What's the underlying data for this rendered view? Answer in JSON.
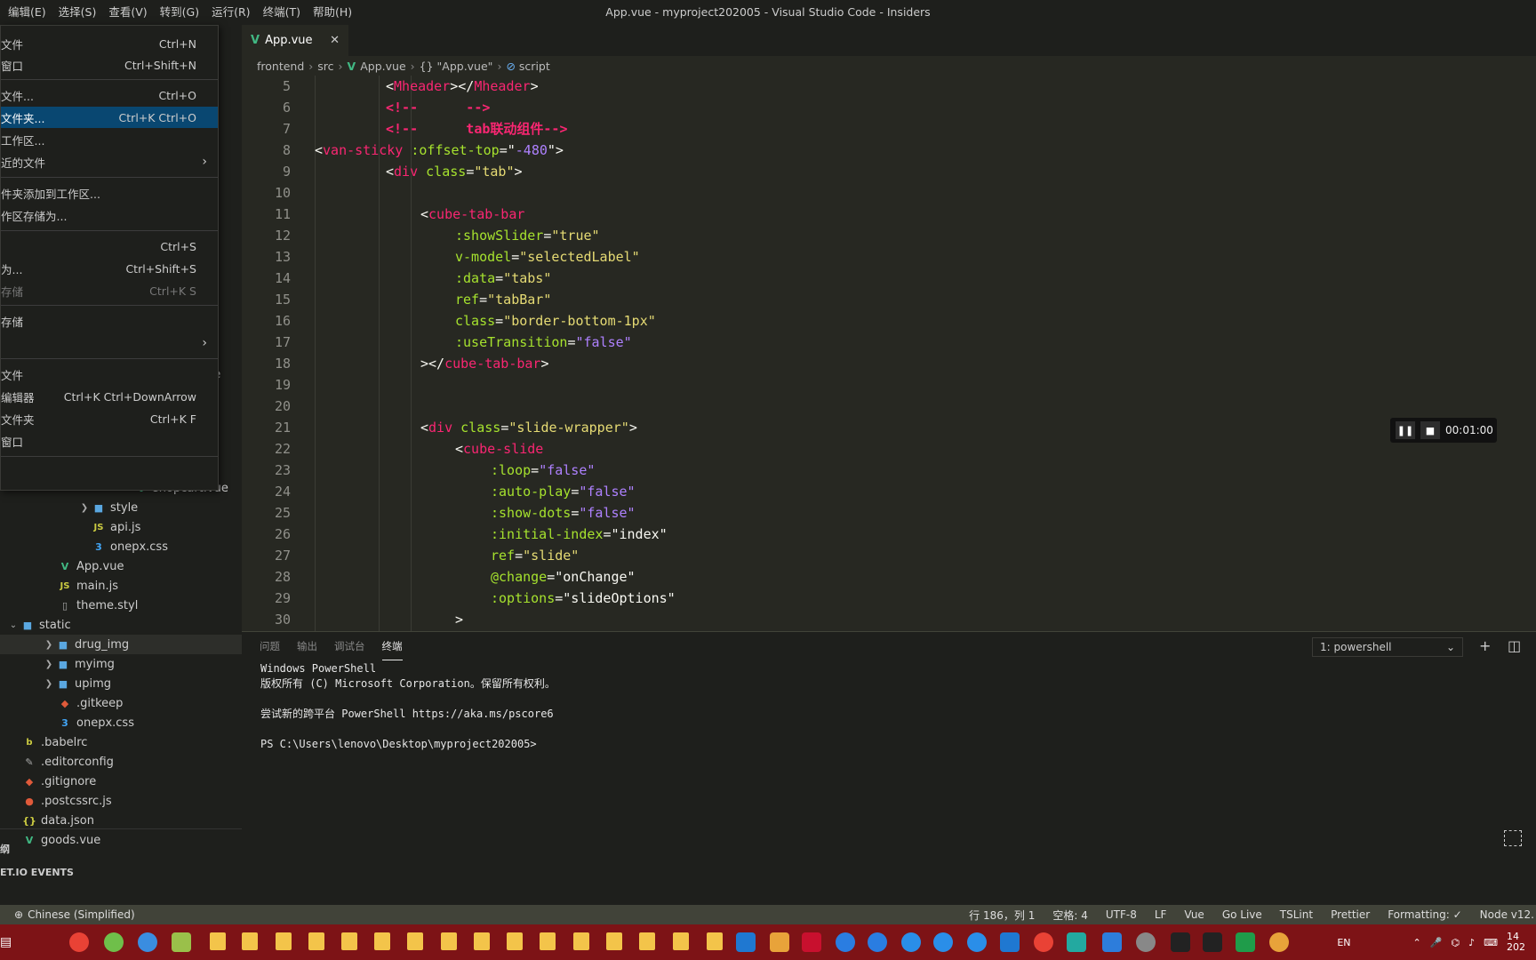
{
  "window_title": "App.vue - myproject202005 - Visual Studio Code - Insiders",
  "menubar": [
    "编辑(E)",
    "选择(S)",
    "查看(V)",
    "转到(G)",
    "运行(R)",
    "终端(T)",
    "帮助(H)"
  ],
  "file_menu": {
    "items": [
      {
        "label": "文件",
        "shortcut": "Ctrl+N"
      },
      {
        "label": "窗口",
        "shortcut": "Ctrl+Shift+N"
      },
      {
        "label": "文件...",
        "shortcut": "Ctrl+O"
      },
      {
        "label": "文件夹...",
        "shortcut": "Ctrl+K Ctrl+O"
      },
      {
        "label": "工作区...",
        "shortcut": ""
      },
      {
        "label": "近的文件",
        "shortcut": ""
      },
      {
        "label": "件夹添加到工作区...",
        "shortcut": ""
      },
      {
        "label": "作区存储为...",
        "shortcut": ""
      },
      {
        "label": "",
        "shortcut": "Ctrl+S"
      },
      {
        "label": "为...",
        "shortcut": "Ctrl+Shift+S"
      },
      {
        "label": "存储",
        "shortcut": "Ctrl+K S"
      },
      {
        "label": "存储",
        "shortcut": ""
      },
      {
        "label": "",
        "shortcut": ""
      },
      {
        "label": "文件",
        "shortcut": ""
      },
      {
        "label": "编辑器",
        "shortcut": "Ctrl+K Ctrl+DownArrow"
      },
      {
        "label": "文件夹",
        "shortcut": "Ctrl+K F"
      },
      {
        "label": "窗口",
        "shortcut": ""
      },
      {
        "label": "",
        "shortcut": ""
      }
    ]
  },
  "explorer": {
    "visible_behind_menu": [
      "ue",
      "e",
      "shopcart.vue"
    ],
    "items": [
      {
        "label": "style",
        "type": "folder"
      },
      {
        "label": "api.js",
        "type": "js"
      },
      {
        "label": "onepx.css",
        "type": "css"
      },
      {
        "label": "App.vue",
        "type": "vue"
      },
      {
        "label": "main.js",
        "type": "js"
      },
      {
        "label": "theme.styl",
        "type": "file"
      },
      {
        "label": "static",
        "type": "folder-open"
      },
      {
        "label": "drug_img",
        "type": "folder"
      },
      {
        "label": "myimg",
        "type": "folder"
      },
      {
        "label": "upimg",
        "type": "folder"
      },
      {
        "label": ".gitkeep",
        "type": "git"
      },
      {
        "label": "onepx.css",
        "type": "css"
      },
      {
        "label": ".babelrc",
        "type": "babel"
      },
      {
        "label": ".editorconfig",
        "type": "config"
      },
      {
        "label": ".gitignore",
        "type": "git"
      },
      {
        "label": ".postcssrc.js",
        "type": "config"
      },
      {
        "label": "data.json",
        "type": "json"
      },
      {
        "label": "goods.vue",
        "type": "vue"
      }
    ],
    "bottom_sections": [
      "纲",
      "ET.IO EVENTS"
    ]
  },
  "editor": {
    "tab": {
      "label": "App.vue",
      "close": "✕"
    },
    "breadcrumb": [
      "frontend",
      "src",
      "App.vue",
      "{} \"App.vue\"",
      "script"
    ],
    "lines": [
      {
        "n": "5"
      },
      {
        "n": "6"
      },
      {
        "n": "7"
      },
      {
        "n": "8"
      },
      {
        "n": "9"
      },
      {
        "n": "10"
      },
      {
        "n": "11"
      },
      {
        "n": "12"
      },
      {
        "n": "13"
      },
      {
        "n": "14"
      },
      {
        "n": "15"
      },
      {
        "n": "16"
      },
      {
        "n": "17"
      },
      {
        "n": "18"
      },
      {
        "n": "19"
      },
      {
        "n": "20"
      },
      {
        "n": "21"
      },
      {
        "n": "22"
      },
      {
        "n": "23"
      },
      {
        "n": "24"
      },
      {
        "n": "25"
      },
      {
        "n": "26"
      },
      {
        "n": "27"
      },
      {
        "n": "28"
      },
      {
        "n": "29"
      },
      {
        "n": "30"
      }
    ],
    "code": {
      "l5": [
        "<",
        "Mheader",
        "></",
        "Mheader",
        ">"
      ],
      "l6": "<!--      -->",
      "l7": "<!--      tab联动组件-->",
      "l8": [
        "<",
        "van-sticky",
        " :offset-top",
        "=\"",
        "-480",
        "\">"
      ],
      "l9": [
        "<",
        "div",
        " class",
        "=",
        "\"tab\"",
        ">"
      ],
      "l11": [
        "<",
        "cube-tab-bar"
      ],
      "l12": [
        ":showSlider",
        "=",
        "\"true\""
      ],
      "l13": [
        "v-model",
        "=",
        "\"selectedLabel\""
      ],
      "l14": [
        ":data",
        "=",
        "\"tabs\""
      ],
      "l15": [
        "ref",
        "=",
        "\"tabBar\""
      ],
      "l16": [
        "class",
        "=",
        "\"border-bottom-1px\""
      ],
      "l17": [
        ":useTransition",
        "=",
        "\"false\""
      ],
      "l18": [
        "></",
        "cube-tab-bar",
        ">"
      ],
      "l21": [
        "<",
        "div",
        " class",
        "=",
        "\"slide-wrapper\"",
        ">"
      ],
      "l22": [
        "<",
        "cube-slide"
      ],
      "l23": [
        ":loop",
        "=",
        "\"false\""
      ],
      "l24": [
        ":auto-play",
        "=",
        "\"false\""
      ],
      "l25": [
        ":show-dots",
        "=",
        "\"false\""
      ],
      "l26": [
        ":initial-index",
        "=",
        "\"index\""
      ],
      "l27": [
        "ref",
        "=",
        "\"slide\""
      ],
      "l28": [
        "@change",
        "=",
        "\"onChange\""
      ],
      "l29": [
        ":options",
        "=",
        "\"slideOptions\""
      ],
      "l30": ">"
    }
  },
  "recorder": {
    "time": "00:01:00"
  },
  "panel": {
    "tabs": [
      "问题",
      "输出",
      "调试台",
      "终端"
    ],
    "active_tab": "终端",
    "terminal_select": "1: powershell",
    "terminal_lines": [
      "Windows PowerShell",
      "版权所有 (C) Microsoft Corporation。保留所有权利。",
      "",
      "尝试新的跨平台 PowerShell https://aka.ms/pscore6",
      "",
      "PS C:\\Users\\lenovo\\Desktop\\myproject202005>"
    ]
  },
  "statusbar": {
    "left": "Chinese (Simplified)",
    "items": [
      "行 186，列 1",
      "空格: 4",
      "UTF-8",
      "LF",
      "Vue",
      "Go Live",
      "TSLint",
      "Prettier",
      "Formatting: ✓",
      "Node v12."
    ]
  },
  "taskbar": {
    "tray": [
      "EN",
      "14",
      "202"
    ]
  },
  "colors": {
    "accent": "#094771",
    "statusbar": "#414339",
    "taskbar": "#7d1316"
  }
}
